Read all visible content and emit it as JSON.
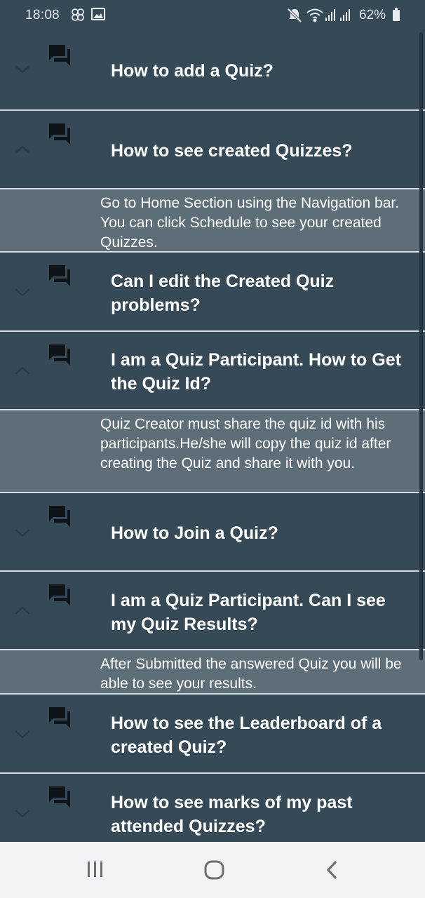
{
  "status_bar": {
    "time": "18:08",
    "battery": "62%",
    "icons": [
      "flower-icon",
      "gallery-icon",
      "mute-icon",
      "wifi-icon",
      "signal-icon",
      "signal-icon",
      "battery-icon"
    ]
  },
  "faq": [
    {
      "question": "How to add a Quiz?",
      "expanded": false
    },
    {
      "question": "How to see created Quizzes?",
      "expanded": true,
      "answer": "Go to Home Section using the Navigation bar. You can click Schedule to see your created Quizzes."
    },
    {
      "question": "Can I edit the Created Quiz problems?",
      "expanded": false
    },
    {
      "question": "I am a Quiz Participant. How to Get the Quiz Id?",
      "expanded": true,
      "answer": "Quiz Creator must share the quiz id with his participants.He/she will copy the quiz id after creating the Quiz and share it with you."
    },
    {
      "question": "How to Join a Quiz?",
      "expanded": false
    },
    {
      "question": "I am a Quiz Participant. Can I see my Quiz Results?",
      "expanded": true,
      "answer": "After Submitted the answered Quiz you will be able to see your results."
    },
    {
      "question": "How to see the Leaderboard of a created Quiz?",
      "expanded": false
    },
    {
      "question": "How to see marks of my past attended Quizzes?",
      "expanded": false
    }
  ],
  "colors": {
    "background": "#364957",
    "answer_background": "#5e6e79",
    "divider": "#d4dce1",
    "nav_bar": "#f2f3f5"
  },
  "nav_bar": {
    "buttons": [
      "recent-apps-icon",
      "home-icon",
      "back-icon"
    ]
  }
}
